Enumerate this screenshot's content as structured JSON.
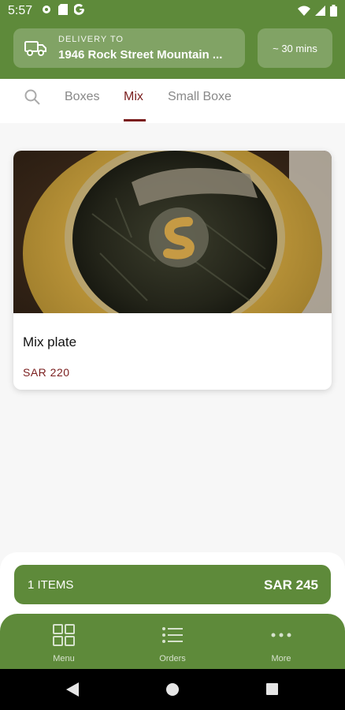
{
  "status_bar": {
    "time": "5:57"
  },
  "header": {
    "delivery_label": "DELIVERY TO",
    "delivery_address": "1946 Rock Street Mountain ...",
    "delivery_time": "~ 30 mins"
  },
  "tabs": [
    {
      "label": "Boxes"
    },
    {
      "label": "Mix"
    },
    {
      "label": "Small Boxe"
    }
  ],
  "product": {
    "title": "Mix plate",
    "price": "SAR 220"
  },
  "cart": {
    "count_label": "1 ITEMS",
    "total": "SAR 245"
  },
  "bottom_nav": [
    {
      "label": "Menu",
      "icon": "grid-icon"
    },
    {
      "label": "Orders",
      "icon": "list-icon"
    },
    {
      "label": "More",
      "icon": "more-dots-icon"
    }
  ],
  "colors": {
    "brand_green": "#5e8a3a",
    "accent_maroon": "#7a1d1d"
  }
}
